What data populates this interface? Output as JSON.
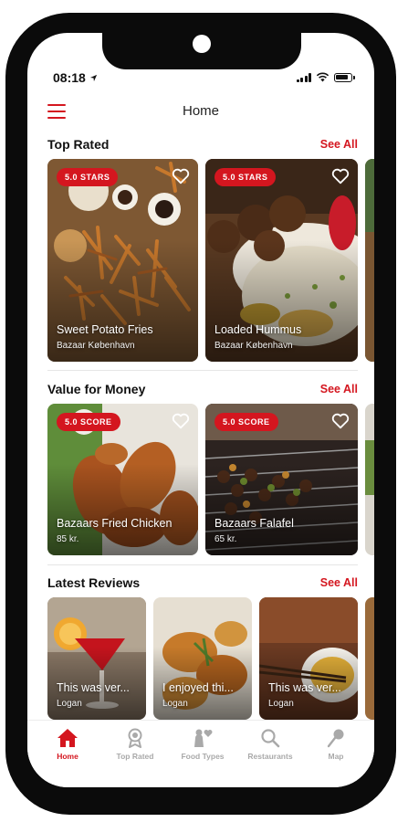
{
  "status_bar": {
    "time": "08:18"
  },
  "header": {
    "title": "Home"
  },
  "sections": [
    {
      "title": "Top Rated",
      "see_all": "See All",
      "cards": [
        {
          "badge": "5.0 STARS",
          "title": "Sweet Potato Fries",
          "subtitle": "Bazaar København"
        },
        {
          "badge": "5.0 STARS",
          "title": "Loaded Hummus",
          "subtitle": "Bazaar København"
        }
      ]
    },
    {
      "title": "Value for Money",
      "see_all": "See All",
      "cards": [
        {
          "badge": "5.0 SCORE",
          "title": "Bazaars Fried Chicken",
          "subtitle": "85 kr."
        },
        {
          "badge": "5.0 SCORE",
          "title": "Bazaars Falafel",
          "subtitle": "65 kr."
        }
      ]
    },
    {
      "title": "Latest Reviews",
      "see_all": "See All",
      "cards": [
        {
          "title": "This was ver...",
          "subtitle": "Logan"
        },
        {
          "title": "I enjoyed thi...",
          "subtitle": "Logan"
        },
        {
          "title": "This was ver...",
          "subtitle": "Logan"
        }
      ]
    }
  ],
  "tabbar": [
    {
      "label": "Home",
      "icon": "home-icon",
      "active": true
    },
    {
      "label": "Top Rated",
      "icon": "award-icon",
      "active": false
    },
    {
      "label": "Food Types",
      "icon": "food-types-icon",
      "active": false
    },
    {
      "label": "Restaurants",
      "icon": "search-icon",
      "active": false
    },
    {
      "label": "Map",
      "icon": "map-pin-icon",
      "active": false
    }
  ],
  "colors": {
    "accent": "#d4161f",
    "inactive": "#a9a9a9",
    "frame": "#0b0b0b"
  }
}
